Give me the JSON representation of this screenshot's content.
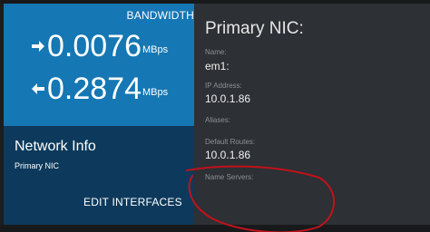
{
  "bandwidth": {
    "title": "BANDWIDTH",
    "upload": {
      "value": "0.0076",
      "unit": "MBps"
    },
    "download": {
      "value": "0.2874",
      "unit": "MBps"
    }
  },
  "network_info": {
    "title": "Network Info",
    "subtitle": "Primary NIC",
    "edit_label": "EDIT INTERFACES"
  },
  "details": {
    "title": "Primary NIC:",
    "name_label": "Name:",
    "name_value": "em1:",
    "ip_label": "IP Address:",
    "ip_value": "10.0.1.86",
    "aliases_label": "Aliases:",
    "routes_label": "Default Routes:",
    "routes_value": "10.0.1.86",
    "dns_label": "Name Servers:"
  },
  "colors": {
    "bandwidth_panel": "#1577b3",
    "network_panel": "#0d3a5c",
    "details_panel": "#2d3034",
    "annotation": "#c0121b"
  }
}
